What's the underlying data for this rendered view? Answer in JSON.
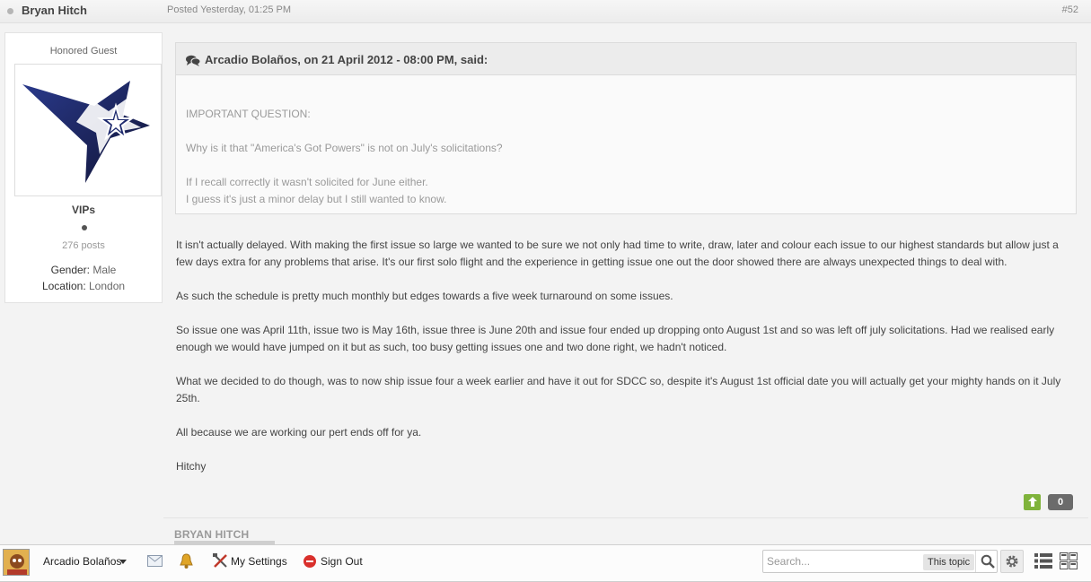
{
  "post": {
    "author": "Bryan Hitch",
    "posted": "Posted Yesterday, 01:25 PM",
    "number": "#52"
  },
  "author_card": {
    "member_title": "Honored Guest",
    "group": "VIPs",
    "posts": "276 posts",
    "gender_label": "Gender:",
    "gender_value": "Male",
    "location_label": "Location:",
    "location_value": "London"
  },
  "quote": {
    "citation": "Arcadio Bolaños, on 21 April 2012 - 08:00 PM, said:",
    "lines": [
      "IMPORTANT QUESTION:",
      "Why is it that \"America's Got Powers\" is not on July's solicitations?",
      "If I recall correctly it wasn't solicited for June either.",
      "I guess it's just a minor delay but I still wanted to know."
    ]
  },
  "body": [
    "It isn't actually delayed. With making the first issue so large we wanted to be sure we not only had time to write, draw, later and colour each issue to our highest standards but allow just a few days extra for any problems that arise. It's our first solo flight and the experience in getting issue one out the door showed there are always unexpected things to deal with.",
    "As such the schedule is pretty much monthly but edges towards a five week turnaround on some issues.",
    "So issue one was April 11th, issue two is May 16th, issue three is June 20th and issue four ended up dropping onto August 1st and so was left off july solicitations. Had we realised early enough we would have jumped on it but as such, too busy getting issues one and two done right, we hadn't noticed.",
    "What we decided to do though, was to now ship issue four a week earlier and have it out for SDCC so, despite it's August 1st official date you will actually get your mighty hands on it July 25th.",
    "All because we are working our pert ends off for ya.",
    "Hitchy"
  ],
  "reputation": {
    "up_icon": "arrow-up-icon",
    "count": "0"
  },
  "signature": {
    "name": "BRYAN HITCH"
  },
  "user_bar": {
    "username": "Arcadio Bolaños",
    "my_settings": "My Settings",
    "sign_out": "Sign Out",
    "search_placeholder": "Search...",
    "search_scope": "This topic"
  },
  "colors": {
    "rep_positive": "#7fb33b",
    "rep_count_bg": "#6b6b6b",
    "star_dark": "#1b2150",
    "sign_out_red": "#d9302c"
  }
}
